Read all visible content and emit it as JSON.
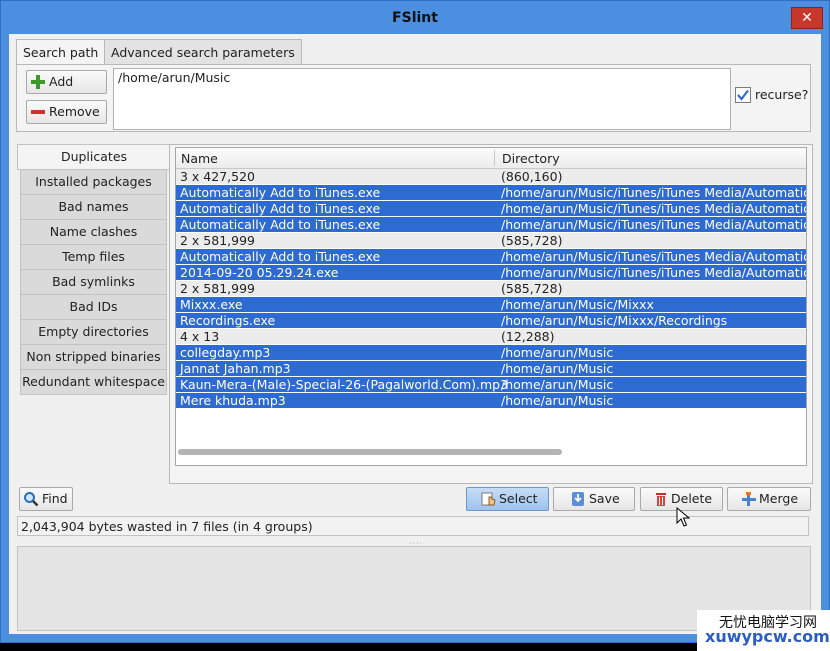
{
  "window": {
    "title": "FSlint",
    "close_glyph": "✕"
  },
  "top_tabs": [
    {
      "label": "Search path",
      "active": true
    },
    {
      "label": "Advanced search parameters",
      "active": false
    }
  ],
  "search": {
    "add_label": "Add",
    "remove_label": "Remove",
    "paths": [
      "/home/arun/Music"
    ],
    "recurse_label": "recurse?",
    "recurse_checked": true
  },
  "side_tabs": [
    {
      "label": "Duplicates",
      "active": true
    },
    {
      "label": "Installed packages"
    },
    {
      "label": "Bad names"
    },
    {
      "label": "Name clashes"
    },
    {
      "label": "Temp files"
    },
    {
      "label": "Bad symlinks"
    },
    {
      "label": "Bad IDs"
    },
    {
      "label": "Empty directories"
    },
    {
      "label": "Non stripped binaries"
    },
    {
      "label": "Redundant whitespace"
    }
  ],
  "list": {
    "columns": [
      "Name",
      "Directory"
    ],
    "rows": [
      {
        "name": "3 x 427,520",
        "dir": "(860,160)",
        "kind": "group"
      },
      {
        "name": "Automatically Add to iTunes.exe",
        "dir": "/home/arun/Music/iTunes/iTunes Media/Automatical",
        "kind": "sel"
      },
      {
        "name": "Automatically Add to iTunes.exe",
        "dir": "/home/arun/Music/iTunes/iTunes Media/Automatical",
        "kind": "sel"
      },
      {
        "name": "Automatically Add to iTunes.exe",
        "dir": "/home/arun/Music/iTunes/iTunes Media/Automatical",
        "kind": "sel"
      },
      {
        "name": "2 x 581,999",
        "dir": "(585,728)",
        "kind": "group"
      },
      {
        "name": "Automatically Add to iTunes.exe",
        "dir": "/home/arun/Music/iTunes/iTunes Media/Automatical",
        "kind": "sel"
      },
      {
        "name": "2014-09-20 05.29.24.exe",
        "dir": "/home/arun/Music/iTunes/iTunes Media/Automatical",
        "kind": "sel"
      },
      {
        "name": "2 x 581,999",
        "dir": "(585,728)",
        "kind": "group"
      },
      {
        "name": "Mixxx.exe",
        "dir": "/home/arun/Music/Mixxx",
        "kind": "sel"
      },
      {
        "name": "Recordings.exe",
        "dir": "/home/arun/Music/Mixxx/Recordings",
        "kind": "sel"
      },
      {
        "name": "4 x 13",
        "dir": "(12,288)",
        "kind": "group"
      },
      {
        "name": "collegday.mp3",
        "dir": "/home/arun/Music",
        "kind": "sel"
      },
      {
        "name": "Jannat Jahan.mp3",
        "dir": "/home/arun/Music",
        "kind": "sel"
      },
      {
        "name": "Kaun-Mera-(Male)-Special-26-(Pagalworld.Com).mp3",
        "dir": "/home/arun/Music",
        "kind": "sel"
      },
      {
        "name": "Mere khuda.mp3",
        "dir": "/home/arun/Music",
        "kind": "sel"
      }
    ]
  },
  "actions": {
    "find_label": "Find",
    "select_label": "Select",
    "save_label": "Save",
    "delete_label": "Delete",
    "merge_label": "Merge"
  },
  "status_text": "2,043,904 bytes wasted in 7 files (in 4 groups)",
  "watermark": {
    "line1": "无忧电脑学习网",
    "line2": "xuwypcw.com"
  },
  "colors": {
    "selection": "#2d6ad1",
    "window_frame": "#4a8fe0",
    "close": "#c7382c"
  }
}
